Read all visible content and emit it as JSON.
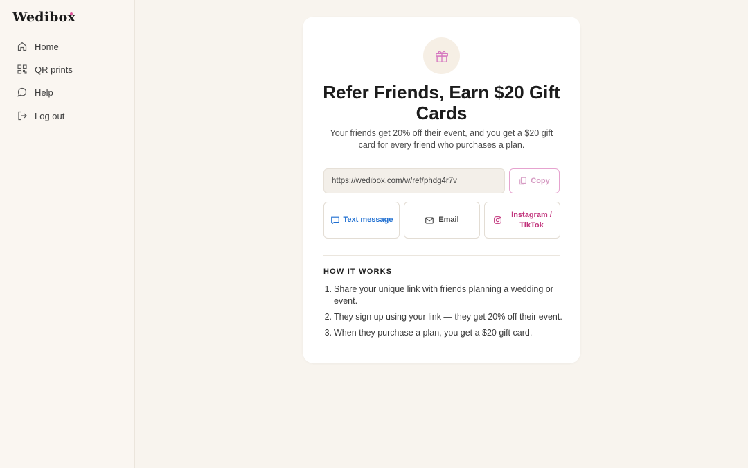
{
  "app": {
    "logo_text": "Wedibox",
    "accent_color": "#e0569b"
  },
  "sidebar": {
    "items": [
      {
        "label": "Home",
        "icon": "home-icon"
      },
      {
        "label": "QR prints",
        "icon": "qr-icon"
      },
      {
        "label": "Help",
        "icon": "chat-bubble-icon"
      },
      {
        "label": "Log out",
        "icon": "logout-icon"
      }
    ]
  },
  "referral": {
    "icon": "gift-icon",
    "title": "Refer Friends, Earn $20 Gift Cards",
    "subtitle": "Your friends get 20% off their event, and you get a $20 gift card for every friend who purchases a plan.",
    "link": "https://wedibox.com/w/ref/phdg4r7v",
    "copy_label": "Copy",
    "share": {
      "text_message": "Text message",
      "email": "Email",
      "instagram": "Instagram / TikTok"
    },
    "colors": {
      "text_message": "#1f6fd1",
      "email": "#3a3a3a",
      "instagram": "#c2347c"
    }
  },
  "how_it_works": {
    "title": "HOW IT WORKS",
    "steps": [
      {
        "num": "1.",
        "text": "Share your unique link with friends planning a wedding or event."
      },
      {
        "num": "2.",
        "text": "They sign up using your link — they get 20% off their event."
      },
      {
        "num": "3.",
        "text": "When they purchase a plan, you get a $20 gift card."
      }
    ]
  }
}
